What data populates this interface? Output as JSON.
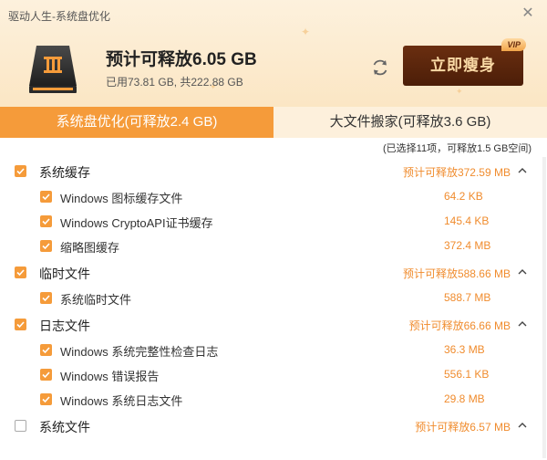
{
  "window": {
    "title": "驱动人生-系统盘优化",
    "close_icon": "close-icon"
  },
  "summary": {
    "headline": "预计可释放6.05 GB",
    "usage": "已用73.81 GB, 共222.88 GB"
  },
  "actions": {
    "slim_label": "立即瘦身",
    "vip_badge": "VIP"
  },
  "tabs": [
    {
      "label": "系统盘优化(可释放2.4 GB)",
      "active": true
    },
    {
      "label": "大文件搬家(可释放3.6 GB)",
      "active": false
    }
  ],
  "selection_info": "(已选择11项，可释放1.5 GB空间)",
  "groups": [
    {
      "label": "系统缓存",
      "size": "预计可释放372.59 MB",
      "checked": true,
      "items": [
        {
          "label": "Windows 图标缓存文件",
          "size": "64.2 KB"
        },
        {
          "label": "Windows CryptoAPI证书缓存",
          "size": "145.4 KB"
        },
        {
          "label": "缩略图缓存",
          "size": "372.4 MB"
        }
      ]
    },
    {
      "label": "临时文件",
      "size": "预计可释放588.66 MB",
      "checked": true,
      "items": [
        {
          "label": "系统临时文件",
          "size": "588.7 MB"
        }
      ]
    },
    {
      "label": "日志文件",
      "size": "预计可释放66.66 MB",
      "checked": true,
      "items": [
        {
          "label": "Windows 系统完整性检查日志",
          "size": "36.3 MB"
        },
        {
          "label": "Windows 错误报告",
          "size": "556.1 KB"
        },
        {
          "label": "Windows 系统日志文件",
          "size": "29.8 MB"
        }
      ]
    },
    {
      "label": "系统文件",
      "size": "预计可释放6.57 MB",
      "checked": false,
      "items": []
    }
  ],
  "colors": {
    "accent": "#f59b3a",
    "brand_dark": "#5a2610",
    "size_text": "#f08c2e"
  }
}
